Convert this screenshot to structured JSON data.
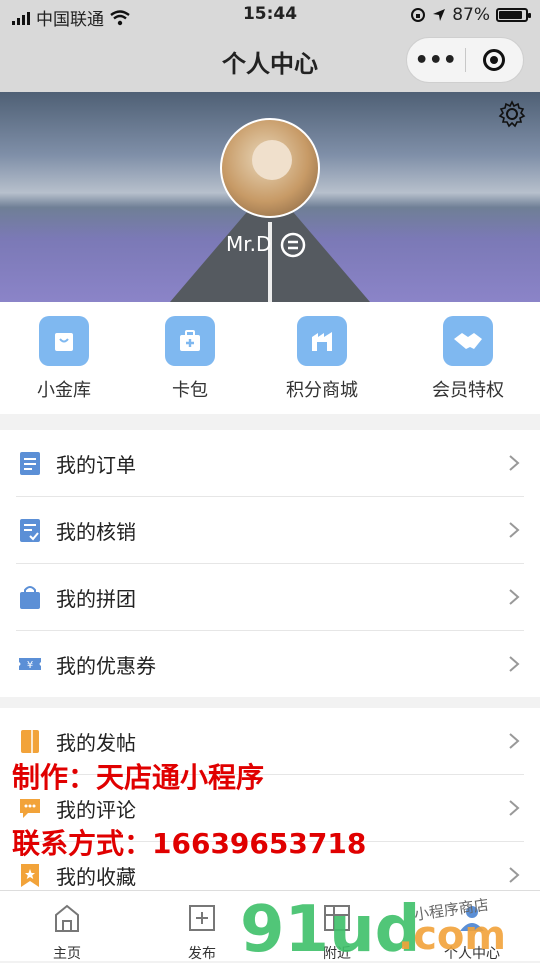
{
  "status": {
    "carrier": "中国联通",
    "time": "15:44",
    "battery": "87%",
    "battery_level": 0.87
  },
  "nav": {
    "title": "个人中心",
    "more_label": "•••"
  },
  "profile": {
    "username": "Mr.D"
  },
  "quick_actions": [
    {
      "label": "小金库",
      "icon": "shopping-bag-icon"
    },
    {
      "label": "卡包",
      "icon": "card-wallet-icon"
    },
    {
      "label": "积分商城",
      "icon": "points-mall-icon"
    },
    {
      "label": "会员特权",
      "icon": "handshake-icon"
    }
  ],
  "menu_group1": [
    {
      "label": "我的订单",
      "icon": "order-icon"
    },
    {
      "label": "我的核销",
      "icon": "verify-icon"
    },
    {
      "label": "我的拼团",
      "icon": "group-buy-icon"
    },
    {
      "label": "我的优惠券",
      "icon": "coupon-icon"
    }
  ],
  "menu_group2": [
    {
      "label": "我的发帖",
      "icon": "posts-icon"
    },
    {
      "label": "我的评论",
      "icon": "comments-icon"
    },
    {
      "label": "我的收藏",
      "icon": "favorites-icon"
    }
  ],
  "overlay": {
    "line1": "制作：天店通小程序",
    "line2": "联系方式：16639653718"
  },
  "tabs": [
    {
      "label": "主页",
      "icon": "home-icon"
    },
    {
      "label": "发布",
      "icon": "add-icon"
    },
    {
      "label": "附近",
      "icon": "nearby-icon"
    },
    {
      "label": "个人中心",
      "icon": "user-icon"
    }
  ],
  "watermark": {
    "brand": "91ud",
    "suffix": ".com",
    "tagline": "小程序商店"
  },
  "colors": {
    "icon_blue": "#7fb8f0",
    "overlay_red": "#e00000",
    "watermark_green": "#3fc06a",
    "watermark_orange": "#f2a33a"
  }
}
